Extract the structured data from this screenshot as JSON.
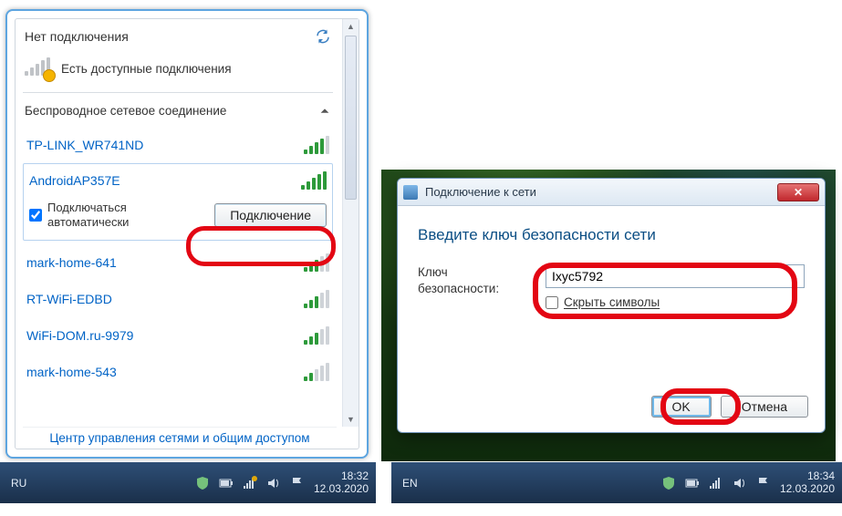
{
  "left": {
    "title": "Нет подключения",
    "available_text": "Есть доступные подключения",
    "section_title": "Беспроводное сетевое соединение",
    "networks": [
      {
        "name": "TP-LINK_WR741ND",
        "strength": 4
      },
      {
        "name": "AndroidAP357E",
        "strength": 5,
        "selected": true
      },
      {
        "name": "mark-home-641",
        "strength": 3
      },
      {
        "name": "RT-WiFi-EDBD",
        "strength": 3
      },
      {
        "name": "WiFi-DOM.ru-9979",
        "strength": 3
      },
      {
        "name": "mark-home-543",
        "strength": 2
      }
    ],
    "auto_connect_line1": "Подключаться",
    "auto_connect_line2": "автоматически",
    "auto_connect_checked": true,
    "connect_btn": "Подключение",
    "footer_link": "Центр управления сетями и общим доступом"
  },
  "taskbar_left": {
    "lang": "RU",
    "time": "18:32",
    "date": "12.03.2020"
  },
  "dialog": {
    "title": "Подключение к сети",
    "heading": "Введите ключ безопасности сети",
    "key_label_line1": "Ключ",
    "key_label_line2": "безопасности:",
    "key_value": "Ixyc5792",
    "hide_chars_label": "Скрыть символы",
    "hide_chars_checked": false,
    "ok_btn": "OK",
    "cancel_btn": "Отмена"
  },
  "taskbar_right": {
    "lang": "EN",
    "time": "18:34",
    "date": "12.03.2020"
  }
}
